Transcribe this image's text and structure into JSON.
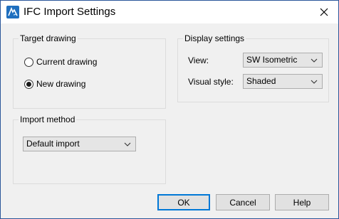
{
  "window": {
    "title": "IFC Import Settings",
    "app_icon": "autocad-icon",
    "close_icon": "close-icon",
    "accent": "#2b579a"
  },
  "target_drawing": {
    "label": "Target drawing",
    "options": [
      {
        "label": "Current drawing",
        "checked": false
      },
      {
        "label": "New drawing",
        "checked": true
      }
    ]
  },
  "display_settings": {
    "label": "Display settings",
    "view": {
      "label": "View:",
      "value": "SW Isometric"
    },
    "visual_style": {
      "label": "Visual style:",
      "value": "Shaded"
    }
  },
  "import_method": {
    "label": "Import method",
    "value": "Default import"
  },
  "buttons": {
    "ok": "OK",
    "cancel": "Cancel",
    "help": "Help"
  }
}
